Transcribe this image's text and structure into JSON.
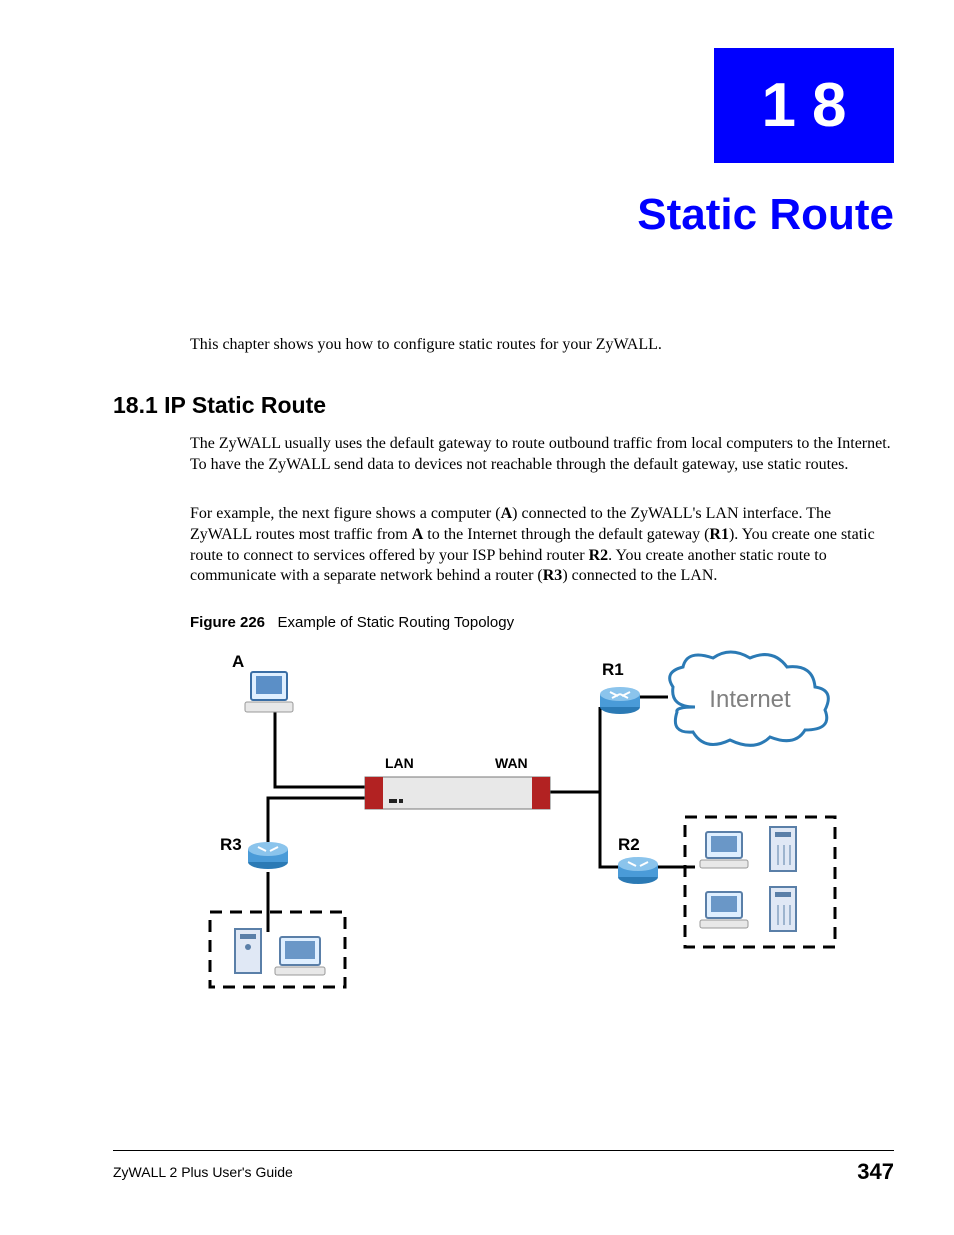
{
  "chapter": {
    "number": "18",
    "title": "Static Route"
  },
  "intro": "This chapter shows you how to configure static routes for your ZyWALL.",
  "section": {
    "heading": "18.1  IP Static Route",
    "para1": "The ZyWALL usually uses the default gateway to route outbound traffic from local computers to the Internet. To have the ZyWALL send data to devices not reachable through the default gateway, use static routes.",
    "para2_pre": "For example, the next figure shows a computer (",
    "para2_A": "A",
    "para2_a": ") connected to the ZyWALL's LAN interface. The ZyWALL routes most traffic from ",
    "para2_A2": "A",
    "para2_b": " to the Internet through the default gateway (",
    "para2_R1": "R1",
    "para2_c": "). You create one static route to connect to services offered by your ISP behind router ",
    "para2_R2": "R2",
    "para2_d": ". You create another static route to communicate with a separate network behind a router (",
    "para2_R3": "R3",
    "para2_e": ") connected to the LAN."
  },
  "figure": {
    "label": "Figure 226",
    "caption": "Example of Static Routing Topology",
    "labels": {
      "A": "A",
      "R1": "R1",
      "R2": "R2",
      "R3": "R3",
      "LAN": "LAN",
      "WAN": "WAN",
      "Internet": "Internet"
    }
  },
  "footer": {
    "title": "ZyWALL 2 Plus User's Guide",
    "page": "347"
  }
}
